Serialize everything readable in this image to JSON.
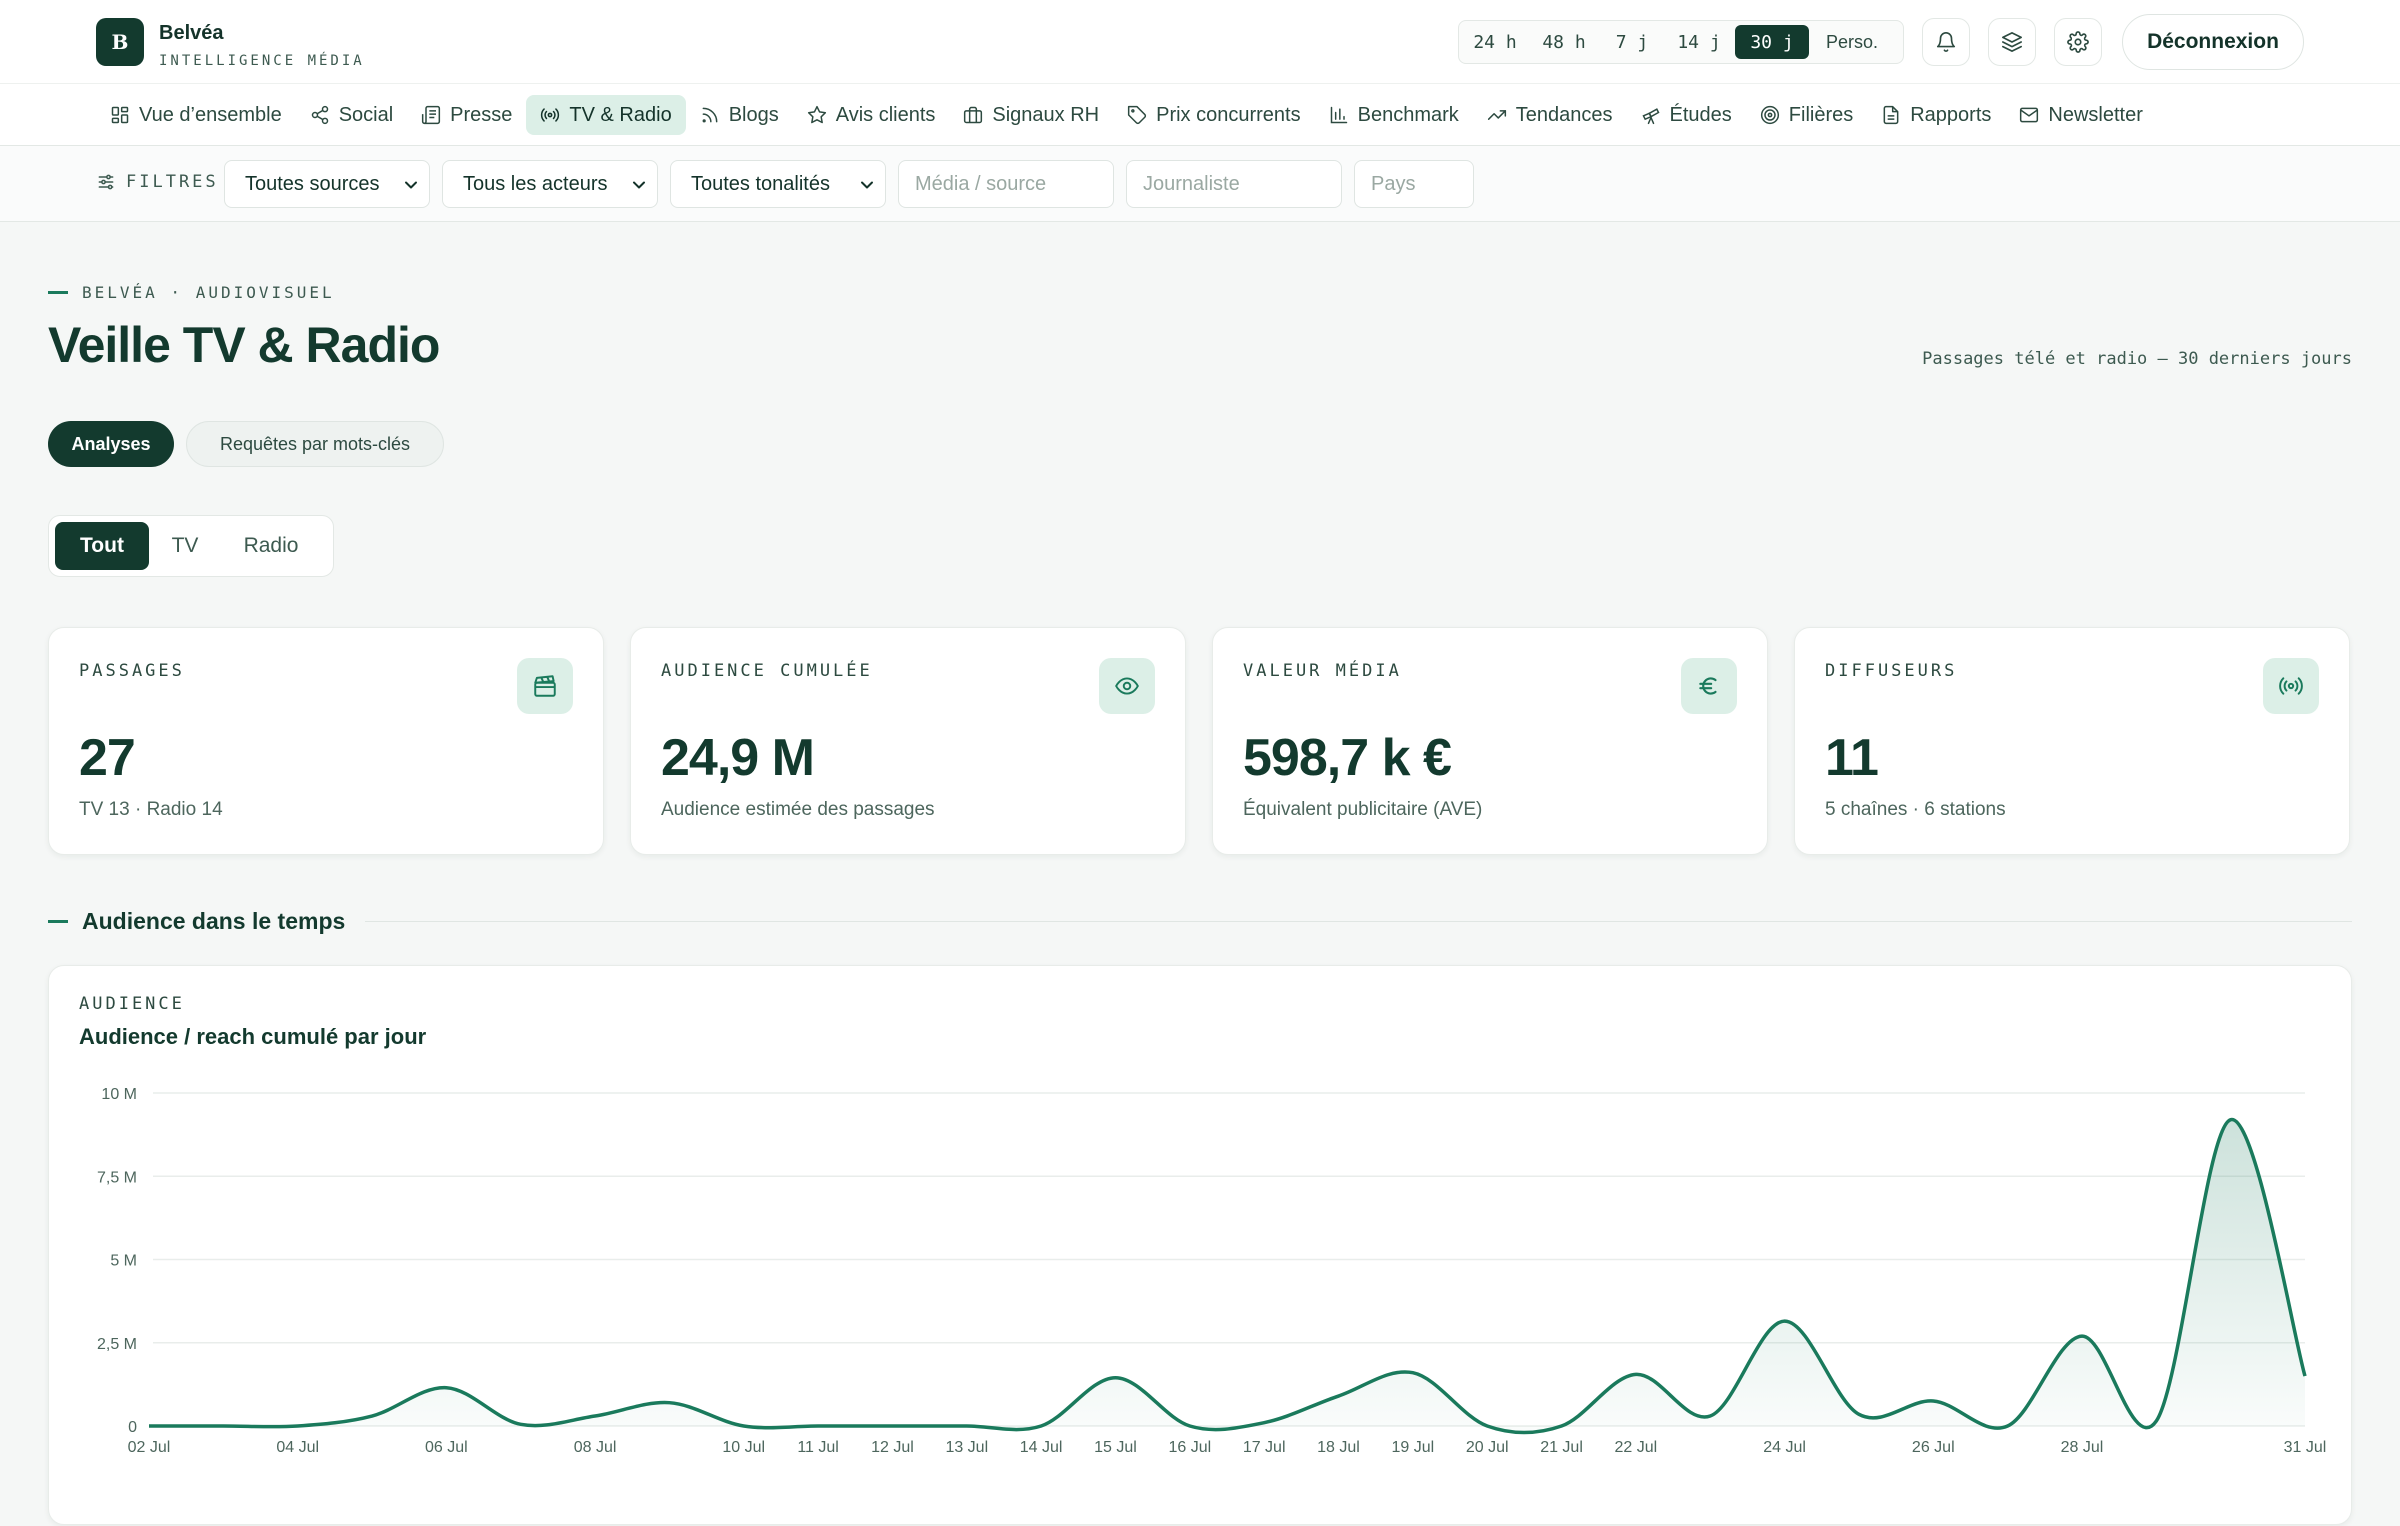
{
  "brand": {
    "logo_letter": "B",
    "name": "Belvéa",
    "tagline": "INTELLIGENCE MÉDIA"
  },
  "period": {
    "options": [
      "24 h",
      "48 h",
      "7 j",
      "14 j",
      "30 j",
      "Perso."
    ],
    "active": "30 j"
  },
  "header_icons": [
    "bell-icon",
    "layers-icon",
    "gear-icon"
  ],
  "logout_label": "Déconnexion",
  "nav": [
    {
      "label": "Vue d’ensemble",
      "icon": "grid-icon"
    },
    {
      "label": "Social",
      "icon": "share-icon"
    },
    {
      "label": "Presse",
      "icon": "newspaper-icon"
    },
    {
      "label": "TV & Radio",
      "icon": "broadcast-icon",
      "active": true
    },
    {
      "label": "Blogs",
      "icon": "rss-icon"
    },
    {
      "label": "Avis clients",
      "icon": "star-icon"
    },
    {
      "label": "Signaux RH",
      "icon": "briefcase-icon"
    },
    {
      "label": "Prix concurrents",
      "icon": "tag-icon"
    },
    {
      "label": "Benchmark",
      "icon": "bar-chart-icon"
    },
    {
      "label": "Tendances",
      "icon": "trend-up-icon"
    },
    {
      "label": "Études",
      "icon": "telescope-icon"
    },
    {
      "label": "Filières",
      "icon": "target-icon"
    },
    {
      "label": "Rapports",
      "icon": "document-icon"
    },
    {
      "label": "Newsletter",
      "icon": "mail-icon"
    }
  ],
  "filters": {
    "label": "FILTRES",
    "sources": "Toutes sources",
    "actors": "Tous les acteurs",
    "tones": "Toutes tonalités",
    "media_placeholder": "Média / source",
    "journalist_placeholder": "Journaliste",
    "country_placeholder": "Pays"
  },
  "page": {
    "eyebrow": "BELVÉA · AUDIOVISUEL",
    "title": "Veille TV & Radio",
    "subtitle": "Passages télé et radio — 30 derniers jours",
    "tabs": [
      "Analyses",
      "Requêtes par mots-clés"
    ],
    "media_filter": [
      "Tout",
      "TV",
      "Radio"
    ]
  },
  "kpis": [
    {
      "label": "PASSAGES",
      "value": "27",
      "sub": "TV 13 · Radio 14",
      "icon": "clapperboard-icon"
    },
    {
      "label": "AUDIENCE CUMULÉE",
      "value": "24,9 M",
      "sub": "Audience estimée des passages",
      "icon": "eye-icon"
    },
    {
      "label": "VALEUR MÉDIA",
      "value": "598,7 k €",
      "sub": "Équivalent publicitaire (AVE)",
      "icon": "euro-icon"
    },
    {
      "label": "DIFFUSEURS",
      "value": "11",
      "sub": "5 chaînes · 6 stations",
      "icon": "broadcast-icon"
    }
  ],
  "section_title": "Audience dans le temps",
  "colors": {
    "accent": "#1a7a5c",
    "dark": "#133a2e",
    "accent_light": "#dcefe7"
  },
  "chart_data": {
    "type": "area",
    "label": "AUDIENCE",
    "title": "Audience / reach cumulé par jour",
    "y_ticks": [
      "0",
      "2,5 M",
      "5 M",
      "7,5 M",
      "10 M"
    ],
    "ylim": [
      0,
      10
    ],
    "unit": "M",
    "x_labels": [
      "02 Jul",
      "04 Jul",
      "06 Jul",
      "08 Jul",
      "10 Jul",
      "11 Jul",
      "12 Jul",
      "13 Jul",
      "14 Jul",
      "15 Jul",
      "16 Jul",
      "17 Jul",
      "18 Jul",
      "19 Jul",
      "20 Jul",
      "21 Jul",
      "22 Jul",
      "24 Jul",
      "26 Jul",
      "28 Jul",
      "31 Jul"
    ],
    "x": [
      "02 Jul",
      "03 Jul",
      "04 Jul",
      "05 Jul",
      "06 Jul",
      "07 Jul",
      "08 Jul",
      "09 Jul",
      "10 Jul",
      "11 Jul",
      "12 Jul",
      "13 Jul",
      "14 Jul",
      "15 Jul",
      "16 Jul",
      "17 Jul",
      "18 Jul",
      "19 Jul",
      "20 Jul",
      "21 Jul",
      "22 Jul",
      "23 Jul",
      "24 Jul",
      "25 Jul",
      "26 Jul",
      "27 Jul",
      "28 Jul",
      "29 Jul",
      "30 Jul",
      "31 Jul"
    ],
    "values": [
      0,
      0,
      0,
      0.3,
      1.15,
      0.05,
      0.3,
      0.7,
      0,
      0,
      0,
      0,
      0,
      1.45,
      0,
      0.1,
      0.9,
      1.6,
      0,
      0,
      1.55,
      0.3,
      3.15,
      0.35,
      0.75,
      0,
      2.7,
      0.15,
      9.2,
      1.5
    ]
  }
}
